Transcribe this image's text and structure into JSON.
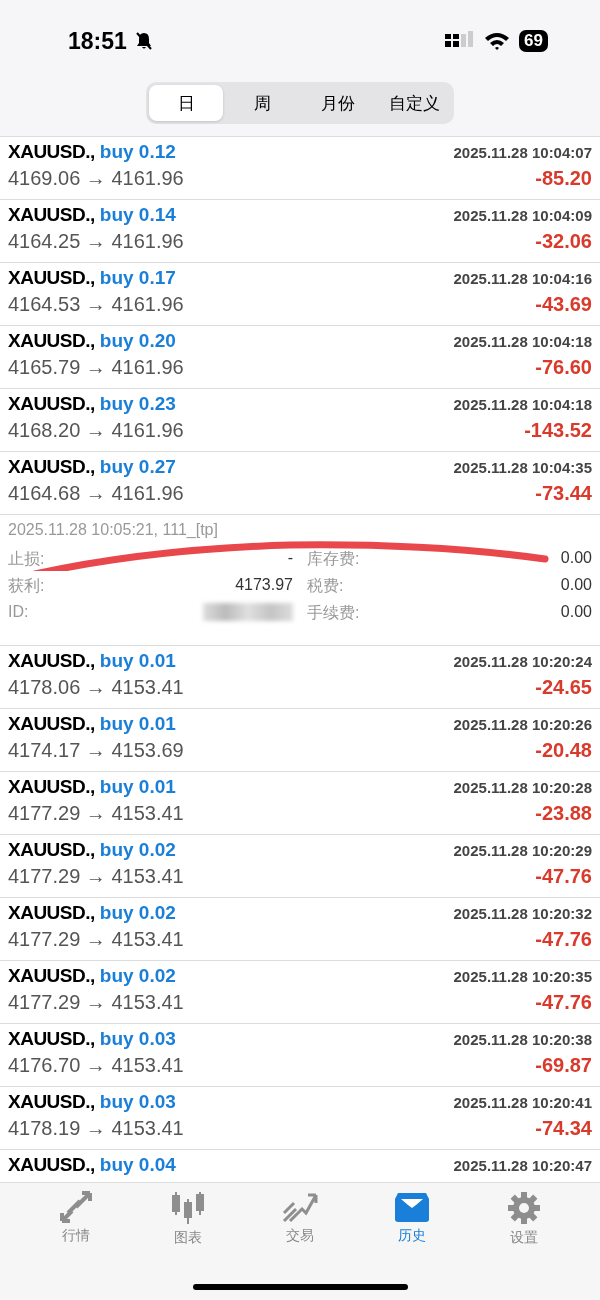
{
  "status_bar": {
    "time": "18:51",
    "battery": "69"
  },
  "periods": [
    {
      "label": "日",
      "selected": true
    },
    {
      "label": "周",
      "selected": false
    },
    {
      "label": "月份",
      "selected": false
    },
    {
      "label": "自定义",
      "selected": false
    }
  ],
  "deals_top": [
    {
      "symbol": "XAUUSD.,",
      "side": "buy 0.12",
      "time": "2025.11.28 10:04:07",
      "prices": "4169.06 → 4161.96",
      "profit": "-85.20"
    },
    {
      "symbol": "XAUUSD.,",
      "side": "buy 0.14",
      "time": "2025.11.28 10:04:09",
      "prices": "4164.25 → 4161.96",
      "profit": "-32.06"
    },
    {
      "symbol": "XAUUSD.,",
      "side": "buy 0.17",
      "time": "2025.11.28 10:04:16",
      "prices": "4164.53 → 4161.96",
      "profit": "-43.69"
    },
    {
      "symbol": "XAUUSD.,",
      "side": "buy 0.20",
      "time": "2025.11.28 10:04:18",
      "prices": "4165.79 → 4161.96",
      "profit": "-76.60"
    },
    {
      "symbol": "XAUUSD.,",
      "side": "buy 0.23",
      "time": "2025.11.28 10:04:18",
      "prices": "4168.20 → 4161.96",
      "profit": "-143.52"
    },
    {
      "symbol": "XAUUSD.,",
      "side": "buy 0.27",
      "time": "2025.11.28 10:04:35",
      "prices": "4164.68 → 4161.96",
      "profit": "-73.44"
    }
  ],
  "detail": {
    "closed": "2025.11.28 10:05:21, 111_[tp]",
    "rows": [
      {
        "left_label": "止损:",
        "left_value": "-",
        "right_label": "库存费:",
        "right_value": "0.00"
      },
      {
        "left_label": "获利:",
        "left_value": "4173.97",
        "right_label": "税费:",
        "right_value": "0.00"
      },
      {
        "left_label": "ID:",
        "right_label": "手续费:",
        "right_value": "0.00"
      }
    ]
  },
  "deals_bottom": [
    {
      "symbol": "XAUUSD.,",
      "side": "buy 0.01",
      "time": "2025.11.28 10:20:24",
      "prices": "4178.06 → 4153.41",
      "profit": "-24.65"
    },
    {
      "symbol": "XAUUSD.,",
      "side": "buy 0.01",
      "time": "2025.11.28 10:20:26",
      "prices": "4174.17 → 4153.69",
      "profit": "-20.48"
    },
    {
      "symbol": "XAUUSD.,",
      "side": "buy 0.01",
      "time": "2025.11.28 10:20:28",
      "prices": "4177.29 → 4153.41",
      "profit": "-23.88"
    },
    {
      "symbol": "XAUUSD.,",
      "side": "buy 0.02",
      "time": "2025.11.28 10:20:29",
      "prices": "4177.29 → 4153.41",
      "profit": "-47.76"
    },
    {
      "symbol": "XAUUSD.,",
      "side": "buy 0.02",
      "time": "2025.11.28 10:20:32",
      "prices": "4177.29 → 4153.41",
      "profit": "-47.76"
    },
    {
      "symbol": "XAUUSD.,",
      "side": "buy 0.02",
      "time": "2025.11.28 10:20:35",
      "prices": "4177.29 → 4153.41",
      "profit": "-47.76"
    },
    {
      "symbol": "XAUUSD.,",
      "side": "buy 0.03",
      "time": "2025.11.28 10:20:38",
      "prices": "4176.70 → 4153.41",
      "profit": "-69.87"
    },
    {
      "symbol": "XAUUSD.,",
      "side": "buy 0.03",
      "time": "2025.11.28 10:20:41",
      "prices": "4178.19 → 4153.41",
      "profit": "-74.34"
    },
    {
      "symbol": "XAUUSD.,",
      "side": "buy 0.04",
      "time": "2025.11.28 10:20:47"
    }
  ],
  "tab_bar": [
    {
      "label": "行情",
      "kind": "quotes",
      "selected": false
    },
    {
      "label": "图表",
      "kind": "chart",
      "selected": false
    },
    {
      "label": "交易",
      "kind": "trade",
      "selected": false
    },
    {
      "label": "历史",
      "kind": "history",
      "selected": true
    },
    {
      "label": "设置",
      "kind": "settings",
      "selected": false
    }
  ]
}
